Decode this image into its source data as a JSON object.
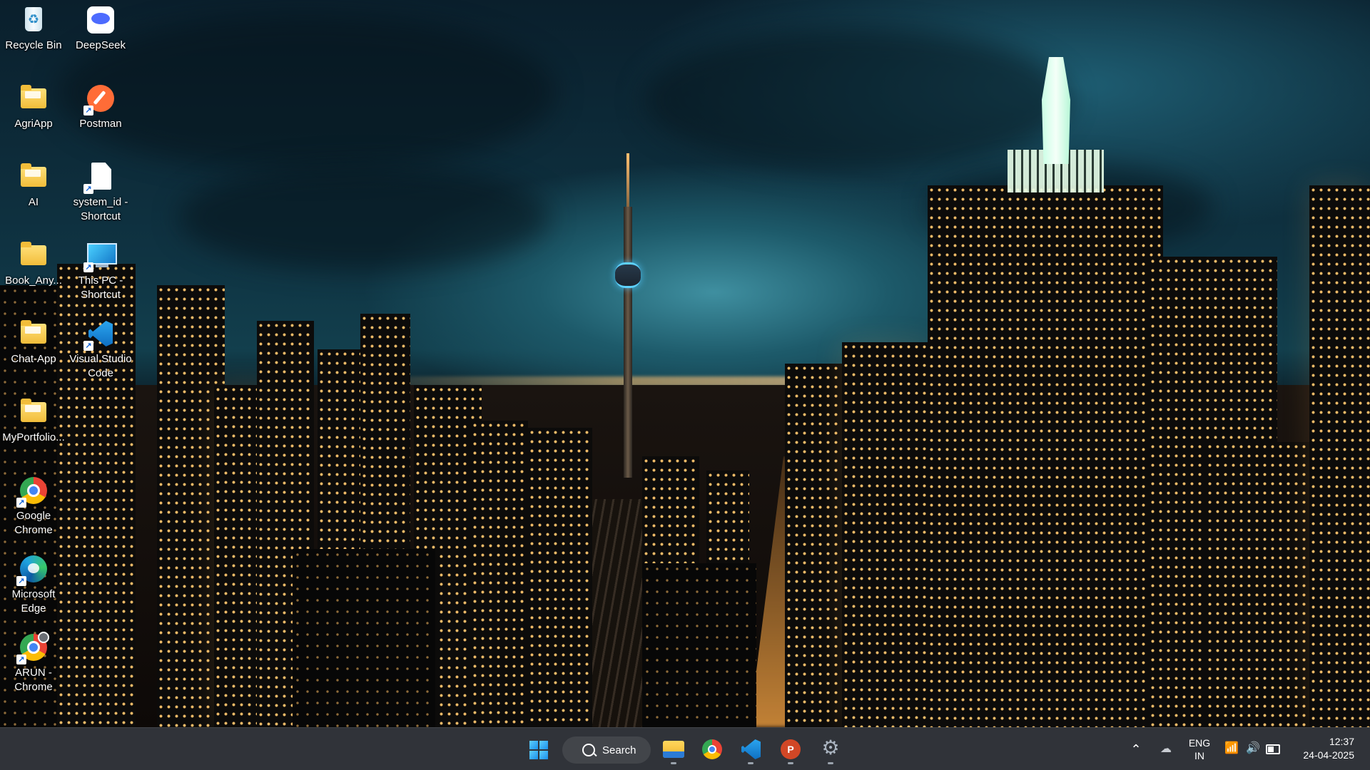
{
  "desktop": {
    "icons": [
      {
        "label": "Recycle Bin",
        "icon": "recycle-bin-icon"
      },
      {
        "label": "DeepSeek",
        "icon": "deepseek-icon"
      },
      {
        "label": "AgriApp",
        "icon": "folder-icon"
      },
      {
        "label": "Postman",
        "icon": "postman-icon"
      },
      {
        "label": "AI",
        "icon": "folder-icon"
      },
      {
        "label": "system_id - Shortcut",
        "icon": "file-shortcut-icon"
      },
      {
        "label": "Book_Any...",
        "icon": "folder-icon"
      },
      {
        "label": "This PC - Shortcut",
        "icon": "this-pc-icon"
      },
      {
        "label": "Chat-App",
        "icon": "folder-icon"
      },
      {
        "label": "Visual Studio Code",
        "icon": "vscode-icon"
      },
      {
        "label": "MyPortfolio...",
        "icon": "folder-icon"
      },
      {
        "label": "Google Chrome",
        "icon": "chrome-icon"
      },
      {
        "label": "Microsoft Edge",
        "icon": "edge-icon"
      },
      {
        "label": "ARUN - Chrome",
        "icon": "chrome-profile-icon"
      }
    ]
  },
  "taskbar": {
    "search_label": "Search",
    "apps": [
      {
        "name": "start",
        "icon": "windows-logo-icon"
      },
      {
        "name": "file-explorer",
        "icon": "file-explorer-icon"
      },
      {
        "name": "chrome",
        "icon": "chrome-icon"
      },
      {
        "name": "vscode",
        "icon": "vscode-icon"
      },
      {
        "name": "powerpoint",
        "icon": "powerpoint-icon"
      },
      {
        "name": "settings",
        "icon": "settings-gear-icon"
      }
    ],
    "tray": {
      "language_line1": "ENG",
      "language_line2": "IN",
      "time": "12:37",
      "date": "24-04-2025"
    }
  },
  "colors": {
    "taskbar_bg": "#1e2228",
    "accent_blue": "#1a8fe8",
    "folder_yellow": "#f2bd3a"
  }
}
